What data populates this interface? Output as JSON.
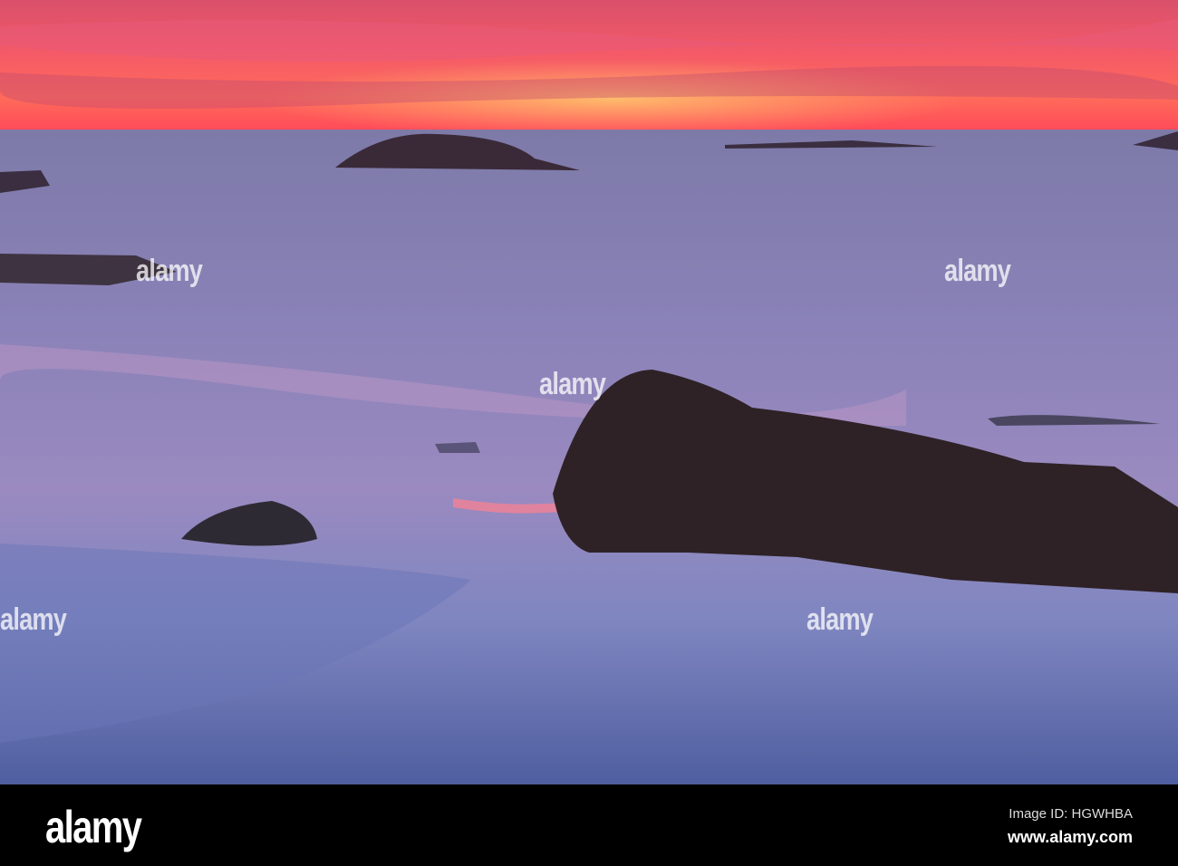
{
  "photo": {
    "subject": "sunset-seashore-rocks"
  },
  "watermark": {
    "text": "alamy"
  },
  "footer": {
    "logo": "alamy",
    "image_id": "Image ID: HGWHBA",
    "website": "www.alamy.com"
  }
}
